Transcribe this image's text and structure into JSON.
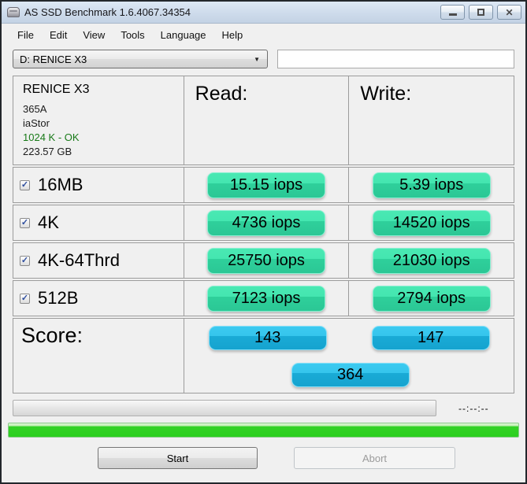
{
  "window": {
    "title": "AS SSD Benchmark 1.6.4067.34354"
  },
  "menu": {
    "items": [
      "File",
      "Edit",
      "View",
      "Tools",
      "Language",
      "Help"
    ]
  },
  "toolbar": {
    "drive_selector_value": "D: RENICE X3",
    "info_field_value": ""
  },
  "drive_info": {
    "name": "RENICE X3",
    "firmware": "365A",
    "driver": "iaStor",
    "alignment": "1024 K - OK",
    "capacity": "223.57 GB"
  },
  "columns": {
    "read": "Read:",
    "write": "Write:"
  },
  "tests": [
    {
      "label": "16MB",
      "checked": true,
      "read": "15.15 iops",
      "write": "5.39 iops"
    },
    {
      "label": "4K",
      "checked": true,
      "read": "4736 iops",
      "write": "14520 iops"
    },
    {
      "label": "4K-64Thrd",
      "checked": true,
      "read": "25750 iops",
      "write": "21030 iops"
    },
    {
      "label": "512B",
      "checked": true,
      "read": "7123 iops",
      "write": "2794 iops"
    }
  ],
  "score": {
    "label": "Score:",
    "read": "143",
    "write": "147",
    "total": "364"
  },
  "progress": {
    "time": "--:--:--"
  },
  "actions": {
    "start": "Start",
    "abort": "Abort"
  },
  "icons": {
    "check": "✓",
    "dropdown_arrow": "▼",
    "close": "✕"
  },
  "colors": {
    "iops_pill_top": "#44e6b0",
    "iops_pill_bottom": "#2bc795",
    "score_pill_top": "#35c5ec",
    "score_pill_bottom": "#15a3cf",
    "alignment_ok_text": "#187a18",
    "progress_fill": "#2bcf1e",
    "titlebar": "#cfdcec"
  }
}
